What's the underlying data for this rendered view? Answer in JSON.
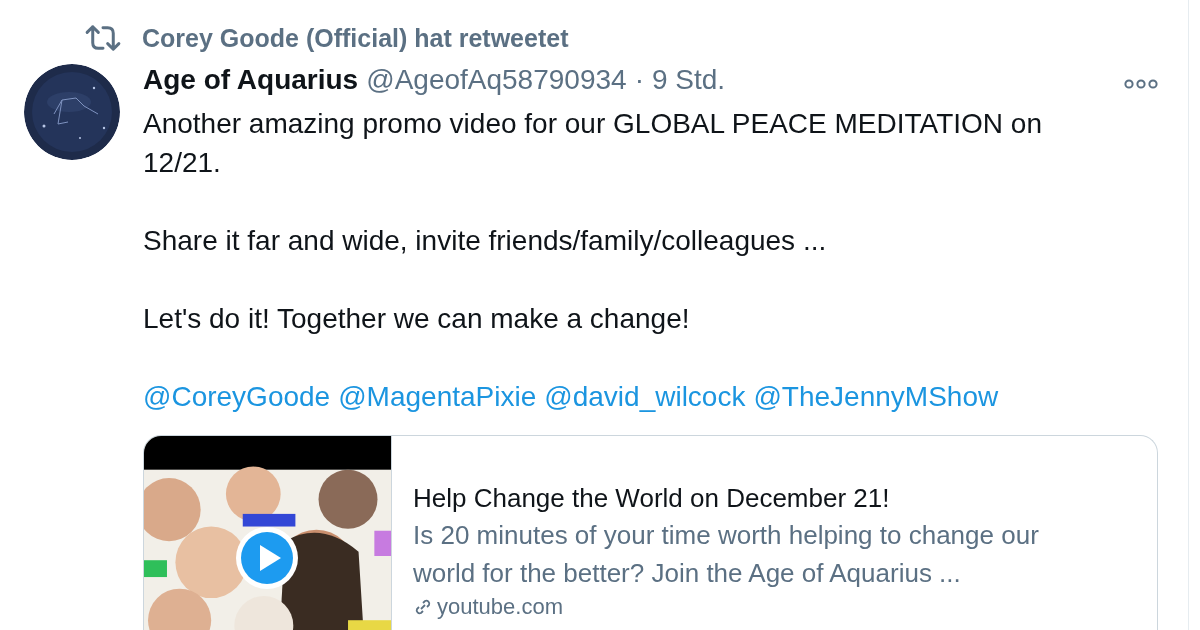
{
  "retweet": {
    "text": "Corey Goode (Official) hat retweetet"
  },
  "tweet": {
    "avatar": {
      "kind": "picture"
    },
    "name": "Age of Aquarius",
    "handle": "@AgeofAq58790934",
    "separator": "·",
    "time": "9 Std.",
    "paragraphs": [
      "Another amazing promo video for our GLOBAL PEACE MEDITATION on 12/21.",
      "Share it far and wide, invite friends/family/colleagues ...",
      "Let's do it! Together we can make a change!"
    ],
    "mentions": [
      "@CoreyGoode",
      "@MagentaPixie",
      "@david_wilcock",
      "@TheJennyMShow"
    ],
    "card": {
      "thumbnail": {
        "kind": "picture"
      },
      "title": "Help Change the World on December 21!",
      "description": "Is 20 minutes of your time worth helping to change our world for the better? Join the Age of Aquarius ...",
      "domain": "youtube.com"
    }
  }
}
